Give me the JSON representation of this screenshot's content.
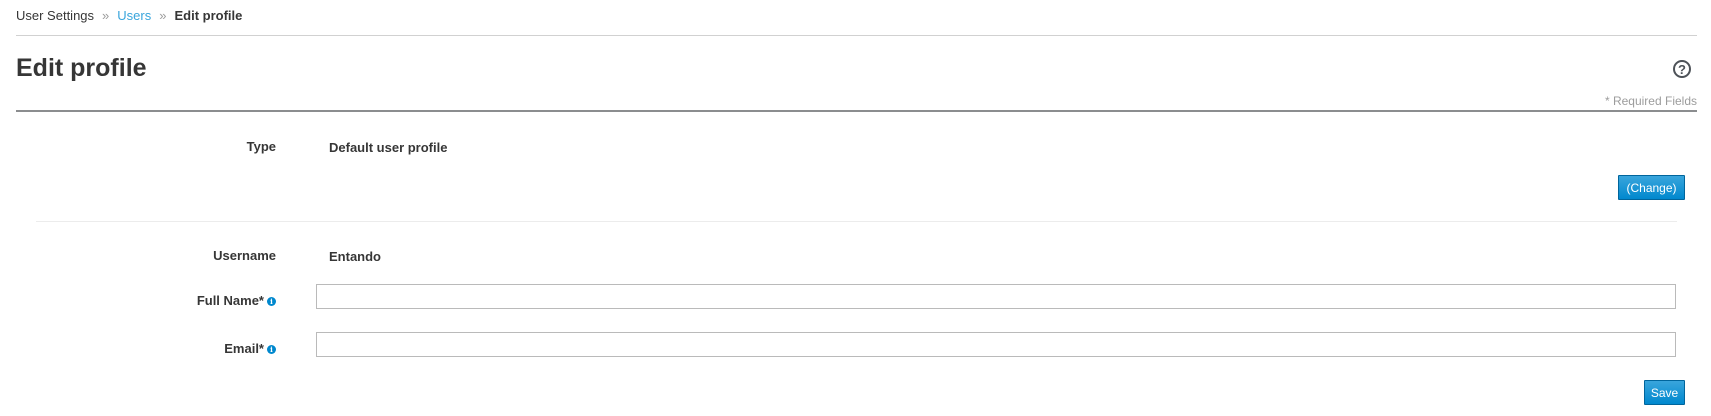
{
  "breadcrumb": {
    "items": [
      "User Settings",
      "Users",
      "Edit profile"
    ],
    "separator": "»"
  },
  "page": {
    "title": "Edit profile",
    "help_icon": "question-circle-icon",
    "required_note": "* Required Fields"
  },
  "type_section": {
    "label": "Type",
    "value": "Default user profile",
    "change_button": "(Change)"
  },
  "form": {
    "username": {
      "label": "Username",
      "value": "Entando"
    },
    "full_name": {
      "label": "Full Name*",
      "value": "",
      "placeholder": "",
      "info_icon": "info-circle-icon"
    },
    "email": {
      "label": "Email*",
      "value": "",
      "placeholder": "",
      "info_icon": "info-circle-icon"
    },
    "save_button": "Save"
  },
  "colors": {
    "link": "#39a5dc",
    "primary_button": "#0088ce",
    "text": "#363636",
    "muted": "#9c9c9c"
  }
}
